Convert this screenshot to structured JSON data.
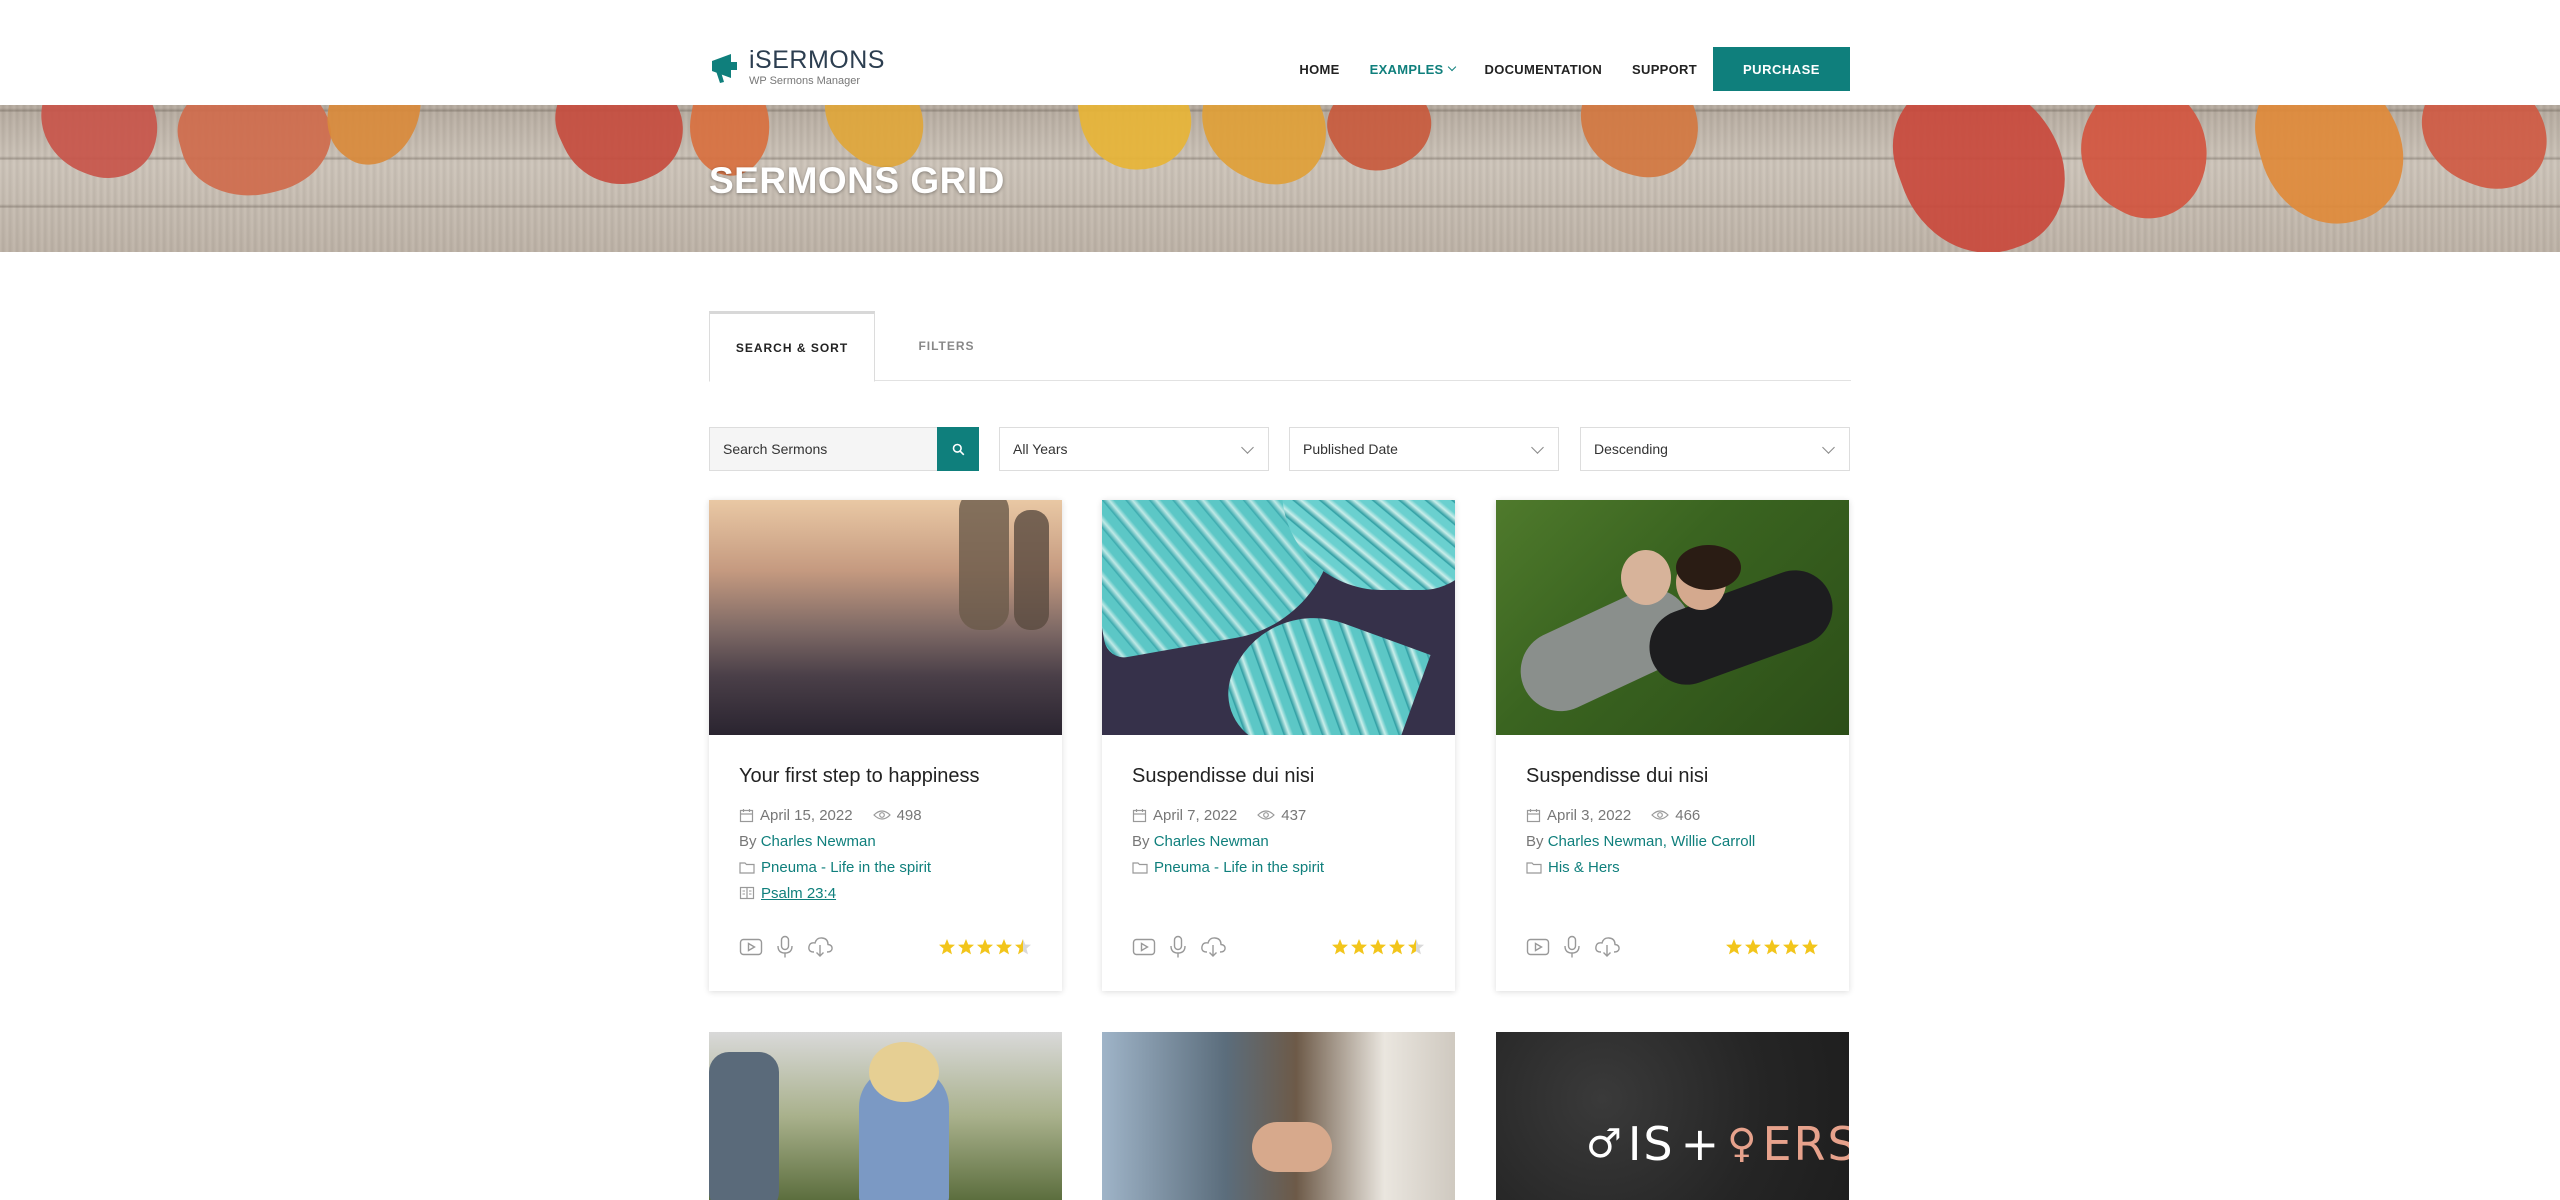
{
  "brand": {
    "title": "iSERMONS",
    "subtitle": "WP Sermons Manager",
    "accent": "#0f7f7c"
  },
  "nav": {
    "items": [
      "HOME",
      "EXAMPLES",
      "DOCUMENTATION",
      "SUPPORT"
    ],
    "active": "EXAMPLES",
    "purchase": "PURCHASE"
  },
  "hero": {
    "title": "SERMONS GRID"
  },
  "tabs": [
    "SEARCH & SORT",
    "FILTERS"
  ],
  "search": {
    "placeholder": "Search Sermons"
  },
  "filters": {
    "year": "All Years",
    "sort": "Published Date",
    "order": "Descending"
  },
  "cards": [
    {
      "title": "Your first step to happiness",
      "date": "April 15, 2022",
      "views": "498",
      "by": "By",
      "speakers": [
        "Charles Newman"
      ],
      "series": "Pneuma - Life in the spirit",
      "passage": "Psalm 23:4",
      "rating": 4.5
    },
    {
      "title": "Suspendisse dui nisi",
      "date": "April 7, 2022",
      "views": "437",
      "by": "By",
      "speakers": [
        "Charles Newman"
      ],
      "series": "Pneuma - Life in the spirit",
      "rating": 4.5
    },
    {
      "title": "Suspendisse dui nisi",
      "date": "April 3, 2022",
      "views": "466",
      "by": "By",
      "speakers": [
        "Charles Newman",
        "Willie Carroll"
      ],
      "speaker_separator": ",",
      "series": "His & Hers",
      "rating": 5
    }
  ],
  "bottom_row": {
    "logo_text_1": "IS",
    "logo_plus": "+",
    "logo_text_2": "ERS"
  },
  "icons": {
    "calendar": "calendar-icon",
    "views": "eye-icon",
    "series": "folder-icon",
    "passage": "book-icon",
    "video": "video-icon",
    "audio": "microphone-icon",
    "download": "cloud-download-icon",
    "search": "search-icon"
  }
}
